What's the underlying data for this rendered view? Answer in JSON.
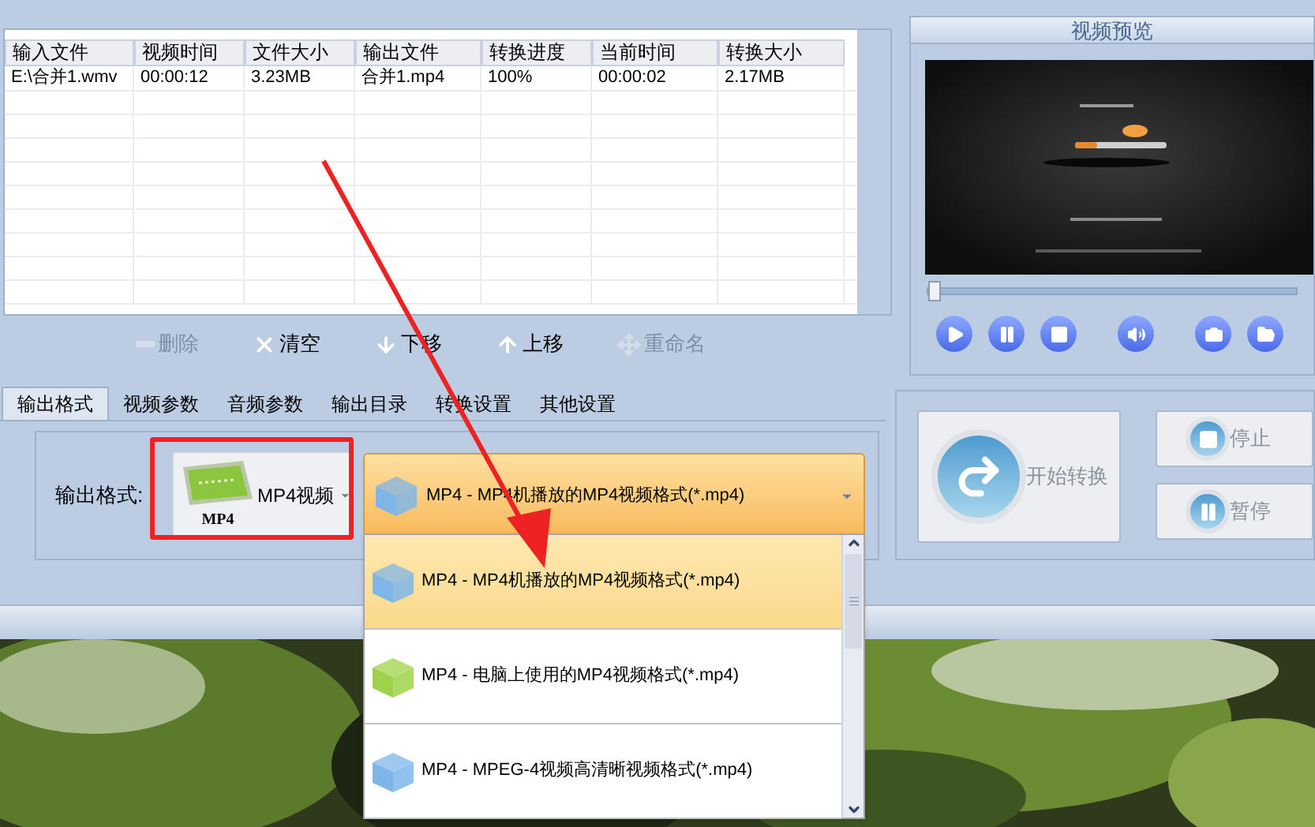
{
  "file_table": {
    "columns": [
      "输入文件",
      "视频时间",
      "文件大小",
      "输出文件",
      "转换进度",
      "当前时间",
      "转换大小"
    ],
    "rows": [
      [
        "E:\\合并1.wmv",
        "00:00:12",
        "3.23MB",
        "合并1.mp4",
        "100%",
        "00:00:02",
        "2.17MB"
      ]
    ]
  },
  "list_actions": [
    {
      "label": "删除",
      "kind": "delete",
      "disabled": true
    },
    {
      "label": "清空",
      "kind": "clear",
      "disabled": false
    },
    {
      "label": "下移",
      "kind": "down",
      "disabled": false
    },
    {
      "label": "上移",
      "kind": "up",
      "disabled": false
    },
    {
      "label": "重命名",
      "kind": "rename",
      "disabled": true
    }
  ],
  "preview": {
    "title": "视频预览",
    "level": 0
  },
  "player_controls": [
    {
      "kind": "play"
    },
    {
      "kind": "pause"
    },
    {
      "kind": "stop"
    },
    {
      "kind": "volume"
    },
    {
      "kind": "snapshot"
    },
    {
      "kind": "folder"
    }
  ],
  "tabs": [
    {
      "label": "输出格式",
      "selected": true
    },
    {
      "label": "视频参数",
      "selected": false
    },
    {
      "label": "音频参数",
      "selected": false
    },
    {
      "label": "输出目录",
      "selected": false
    },
    {
      "label": "转换设置",
      "selected": false
    },
    {
      "label": "其他设置",
      "selected": false
    }
  ],
  "output_format": {
    "label": "输出格式:",
    "format_button": {
      "label": "MP4视频",
      "icon_caption": "MP4"
    },
    "profile": "MP4 - MP4机播放的MP4视频格式(*.mp4)"
  },
  "profile_options": [
    {
      "label": "MP4 - MP4机播放的MP4视频格式(*.mp4)",
      "color": "#7fb6e8",
      "selected": true
    },
    {
      "label": "MP4 - 电脑上使用的MP4视频格式(*.mp4)",
      "color": "#9fd24a",
      "selected": false
    },
    {
      "label": "MP4 - MPEG-4视频高清晰视频格式(*.mp4)",
      "color": "#7fb6e8",
      "selected": false
    }
  ],
  "convert_controls": [
    {
      "label": "开始转换",
      "kind": "start",
      "disabled": true
    },
    {
      "label": "停止",
      "kind": "stop",
      "disabled": true
    },
    {
      "label": "暂停",
      "kind": "pause",
      "disabled": true
    }
  ]
}
